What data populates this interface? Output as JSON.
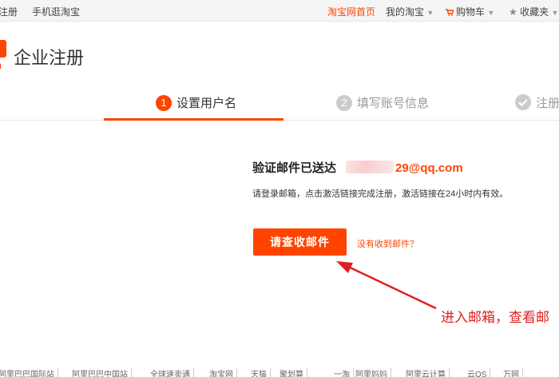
{
  "topbar": {
    "left_links": [
      "注册",
      "手机逛淘宝"
    ],
    "home": "淘宝网首页",
    "my_taobao": "我的淘宝",
    "cart": "购物车",
    "favorites": "收藏夹"
  },
  "header": {
    "title": "企业注册",
    "logo_letter": "n"
  },
  "steps": [
    {
      "num": "1",
      "label": "设置用户名",
      "state": "active"
    },
    {
      "num": "2",
      "label": "填写账号信息",
      "state": "todo"
    },
    {
      "num": "",
      "label": "注册",
      "state": "todo"
    }
  ],
  "main": {
    "sent_label": "验证邮件已送达",
    "email_visible": "29@qq.com",
    "hint": "请登录邮箱，点击激活链接完成注册，激活链接在24小时内有效。",
    "check_mail_button": "请查收邮件",
    "not_received_link": "没有收到邮件？"
  },
  "annotation": {
    "text": "进入邮箱，查看邮"
  },
  "footer": {
    "links": [
      "阿里巴巴国际站",
      "阿里巴巴中国站",
      "全球速卖通",
      "淘宝网",
      "天猫",
      "聚划算",
      "一淘",
      "阿里妈妈",
      "阿里云计算",
      "云OS",
      "万网"
    ]
  },
  "colors": {
    "accent": "#ff4400",
    "annotation": "#e02020"
  }
}
